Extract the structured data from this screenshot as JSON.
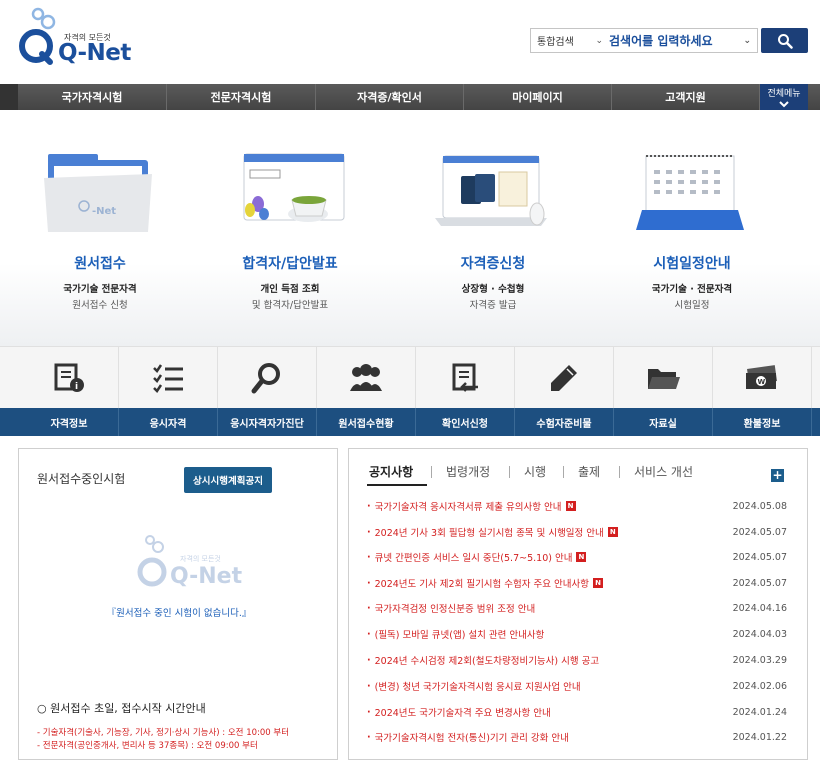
{
  "header": {
    "logo_tagline": "자격의 모든것",
    "logo_word": "Q-Net",
    "search_scope": "통합검색",
    "search_placeholder": "검색어를 입력하세요"
  },
  "gnb": {
    "items": [
      "국가자격시험",
      "전문자격시험",
      "자격증/확인서",
      "마이페이지",
      "고객지원"
    ],
    "all_menu": "전체메뉴"
  },
  "features": [
    {
      "title": "원서접수",
      "line1": "국가기술 전문자격",
      "line2": "원서접수 신청"
    },
    {
      "title": "합격자/답안발표",
      "line1": "개인 득점 조회",
      "line2": "및 합격자/답안발표"
    },
    {
      "title": "자격증신청",
      "line1": "상장형 · 수첩형",
      "line2": "자격증 발급"
    },
    {
      "title": "시험일정안내",
      "line1": "국가기술 · 전문자격",
      "line2": "시험일정"
    }
  ],
  "quick_menu": [
    {
      "label": "자격정보",
      "icon": "info-doc-icon"
    },
    {
      "label": "응시자격",
      "icon": "checklist-icon"
    },
    {
      "label": "응시자격자가진단",
      "icon": "magnifier-icon"
    },
    {
      "label": "원서접수현황",
      "icon": "people-icon"
    },
    {
      "label": "확인서신청",
      "icon": "document-return-icon"
    },
    {
      "label": "수험자준비물",
      "icon": "pencil-icon"
    },
    {
      "label": "자료실",
      "icon": "folder-icon"
    },
    {
      "label": "환불정보",
      "icon": "money-icon"
    }
  ],
  "left_panel": {
    "title": "원서접수중인시험",
    "button": "상시시행계획공지",
    "empty_msg": "『원서접수 중인 시험이 없습니다.』",
    "info_title": "○ 원서접수 초일, 접수시작 시간안내",
    "info_lines": [
      "- 기술자격(기술사, 기능장, 기사, 정기·상시 기능사) : 오전 10:00 부터",
      "- 전문자격(공인중개사, 변리사 등 37종목)          : 오전 09:00 부터"
    ]
  },
  "right_panel": {
    "tabs": [
      "공지사항",
      "법령개정",
      "시행",
      "출제",
      "서비스 개선"
    ],
    "more": "+",
    "notices": [
      {
        "text": "국가기술자격 응시자격서류 제출 유의사항 안내",
        "date": "2024.05.08",
        "new": true
      },
      {
        "text": "2024년 기사 3회 필답형 실기시험 종목 및 시행일정 안내",
        "date": "2024.05.07",
        "new": true
      },
      {
        "text": "큐넷 간편인증 서비스 일시 중단(5.7~5.10) 안내",
        "date": "2024.05.07",
        "new": true
      },
      {
        "text": "2024년도 기사 제2회 필기시험 수험자 주요 안내사항",
        "date": "2024.05.07",
        "new": true
      },
      {
        "text": "국가자격검정 인정신분증 범위 조정 안내",
        "date": "2024.04.16",
        "new": false
      },
      {
        "text": "(필독) 모바일 큐넷(앱) 설치 관련 안내사항",
        "date": "2024.04.03",
        "new": false
      },
      {
        "text": "2024년 수시검정 제2회(철도차량정비기능사) 시행 공고",
        "date": "2024.03.29",
        "new": false
      },
      {
        "text": "(변경) 청년 국가기술자격시험 응시료 지원사업 안내",
        "date": "2024.02.06",
        "new": false
      },
      {
        "text": "2024년도 국가기술자격 주요 변경사항 안내",
        "date": "2024.01.24",
        "new": false
      },
      {
        "text": "국가기술자격시험 전자(통신)기기 관리 강화 안내",
        "date": "2024.01.22",
        "new": false
      }
    ],
    "new_badge": "N"
  }
}
